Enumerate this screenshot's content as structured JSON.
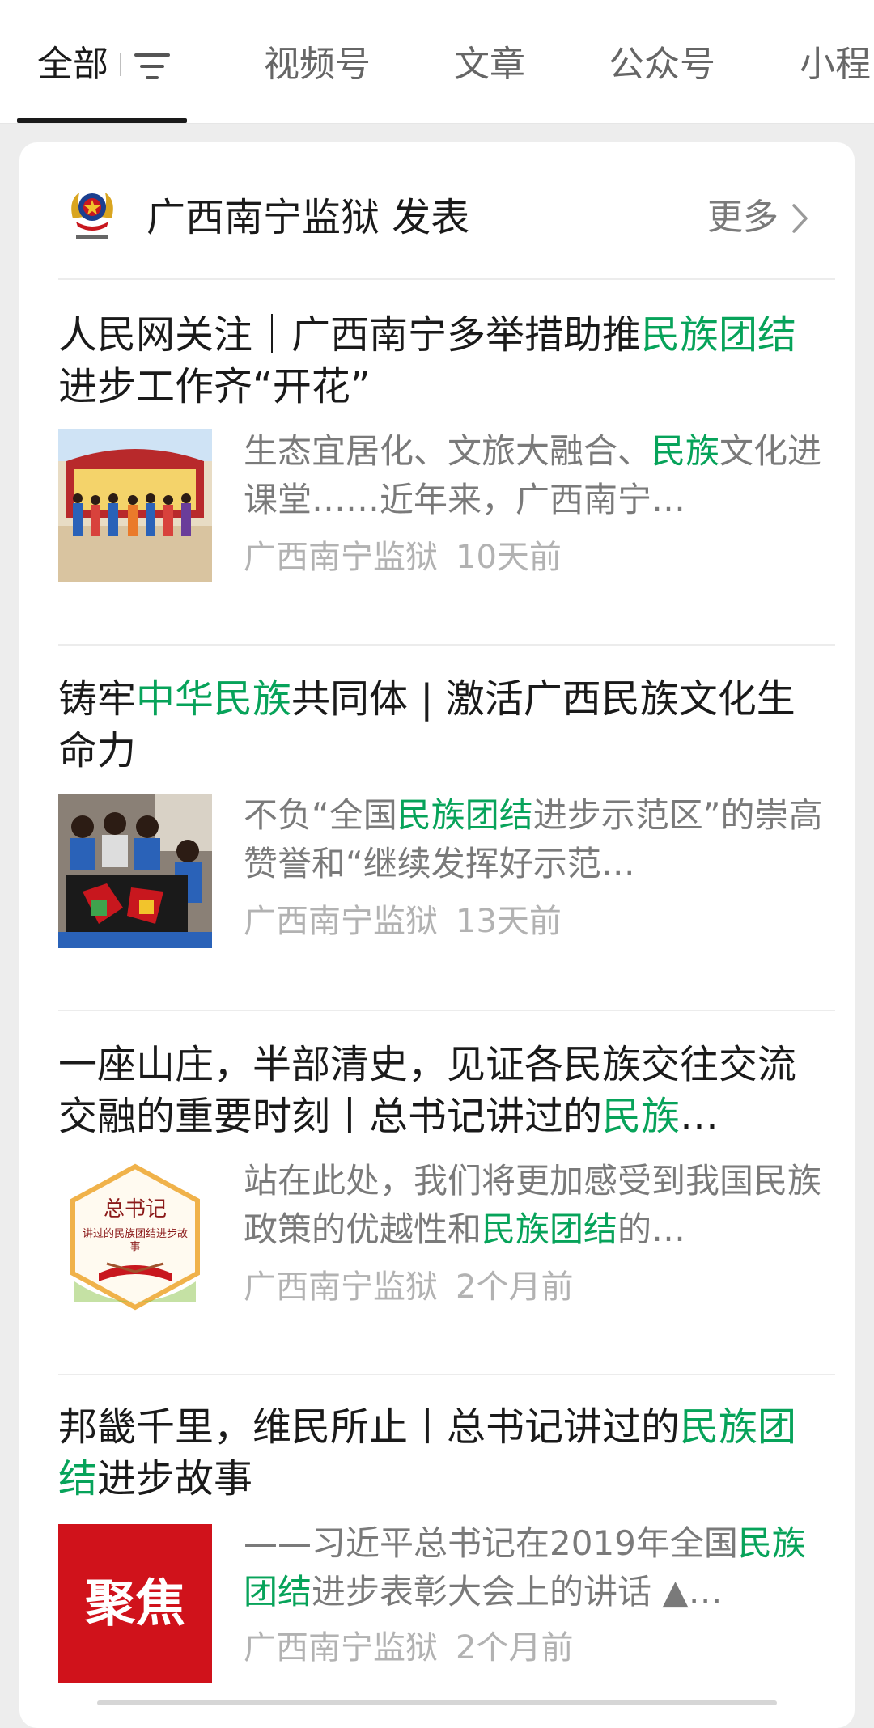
{
  "tabs": {
    "all": "全部",
    "video": "视频号",
    "article": "文章",
    "public": "公众号",
    "mini": "小程"
  },
  "header": {
    "publisher": "广西南宁监狱 发表",
    "more": "更多"
  },
  "articles": [
    {
      "title": [
        "人民网关注｜广西南宁多举措助推",
        "民族团结",
        "进步工作齐“开花”"
      ],
      "desc": [
        "生态宜居化、文旅大融合、",
        "民族",
        "文化进课堂……近年来，广西南宁…"
      ],
      "source": "广西南宁监狱",
      "time": "10天前"
    },
    {
      "title": [
        "铸牢",
        "中华民族",
        "共同体 | 激活广西民族文化生命力"
      ],
      "desc": [
        "不负“全国",
        "民族团结",
        "进步示范区”的崇高赞誉和“继续发挥好示范…"
      ],
      "source": "广西南宁监狱",
      "time": "13天前"
    },
    {
      "title": [
        "一座山庄，半部清史，见证各民族交往交流交融的重要时刻丨总书记讲过的",
        "民族",
        "…"
      ],
      "desc": [
        "站在此处，我们将更加感受到我国民族政策的优越性和",
        "民族团结",
        "的…"
      ],
      "thumb_text": [
        "总书记",
        "讲过的民族团结进步故事"
      ],
      "source": "广西南宁监狱",
      "time": "2个月前"
    },
    {
      "title": [
        "邦畿千里，维民所止丨总书记讲过的",
        "民族团结",
        "进步故事"
      ],
      "desc": [
        "——习近平总书记在2019年全国",
        "民族团结",
        "进步表彰大会上的讲话 ▲…"
      ],
      "thumb_text": "聚焦",
      "source": "广西南宁监狱",
      "time": "2个月前"
    }
  ],
  "colors": {
    "highlight": "#07a35a",
    "thumb_red": "#d0121b"
  }
}
